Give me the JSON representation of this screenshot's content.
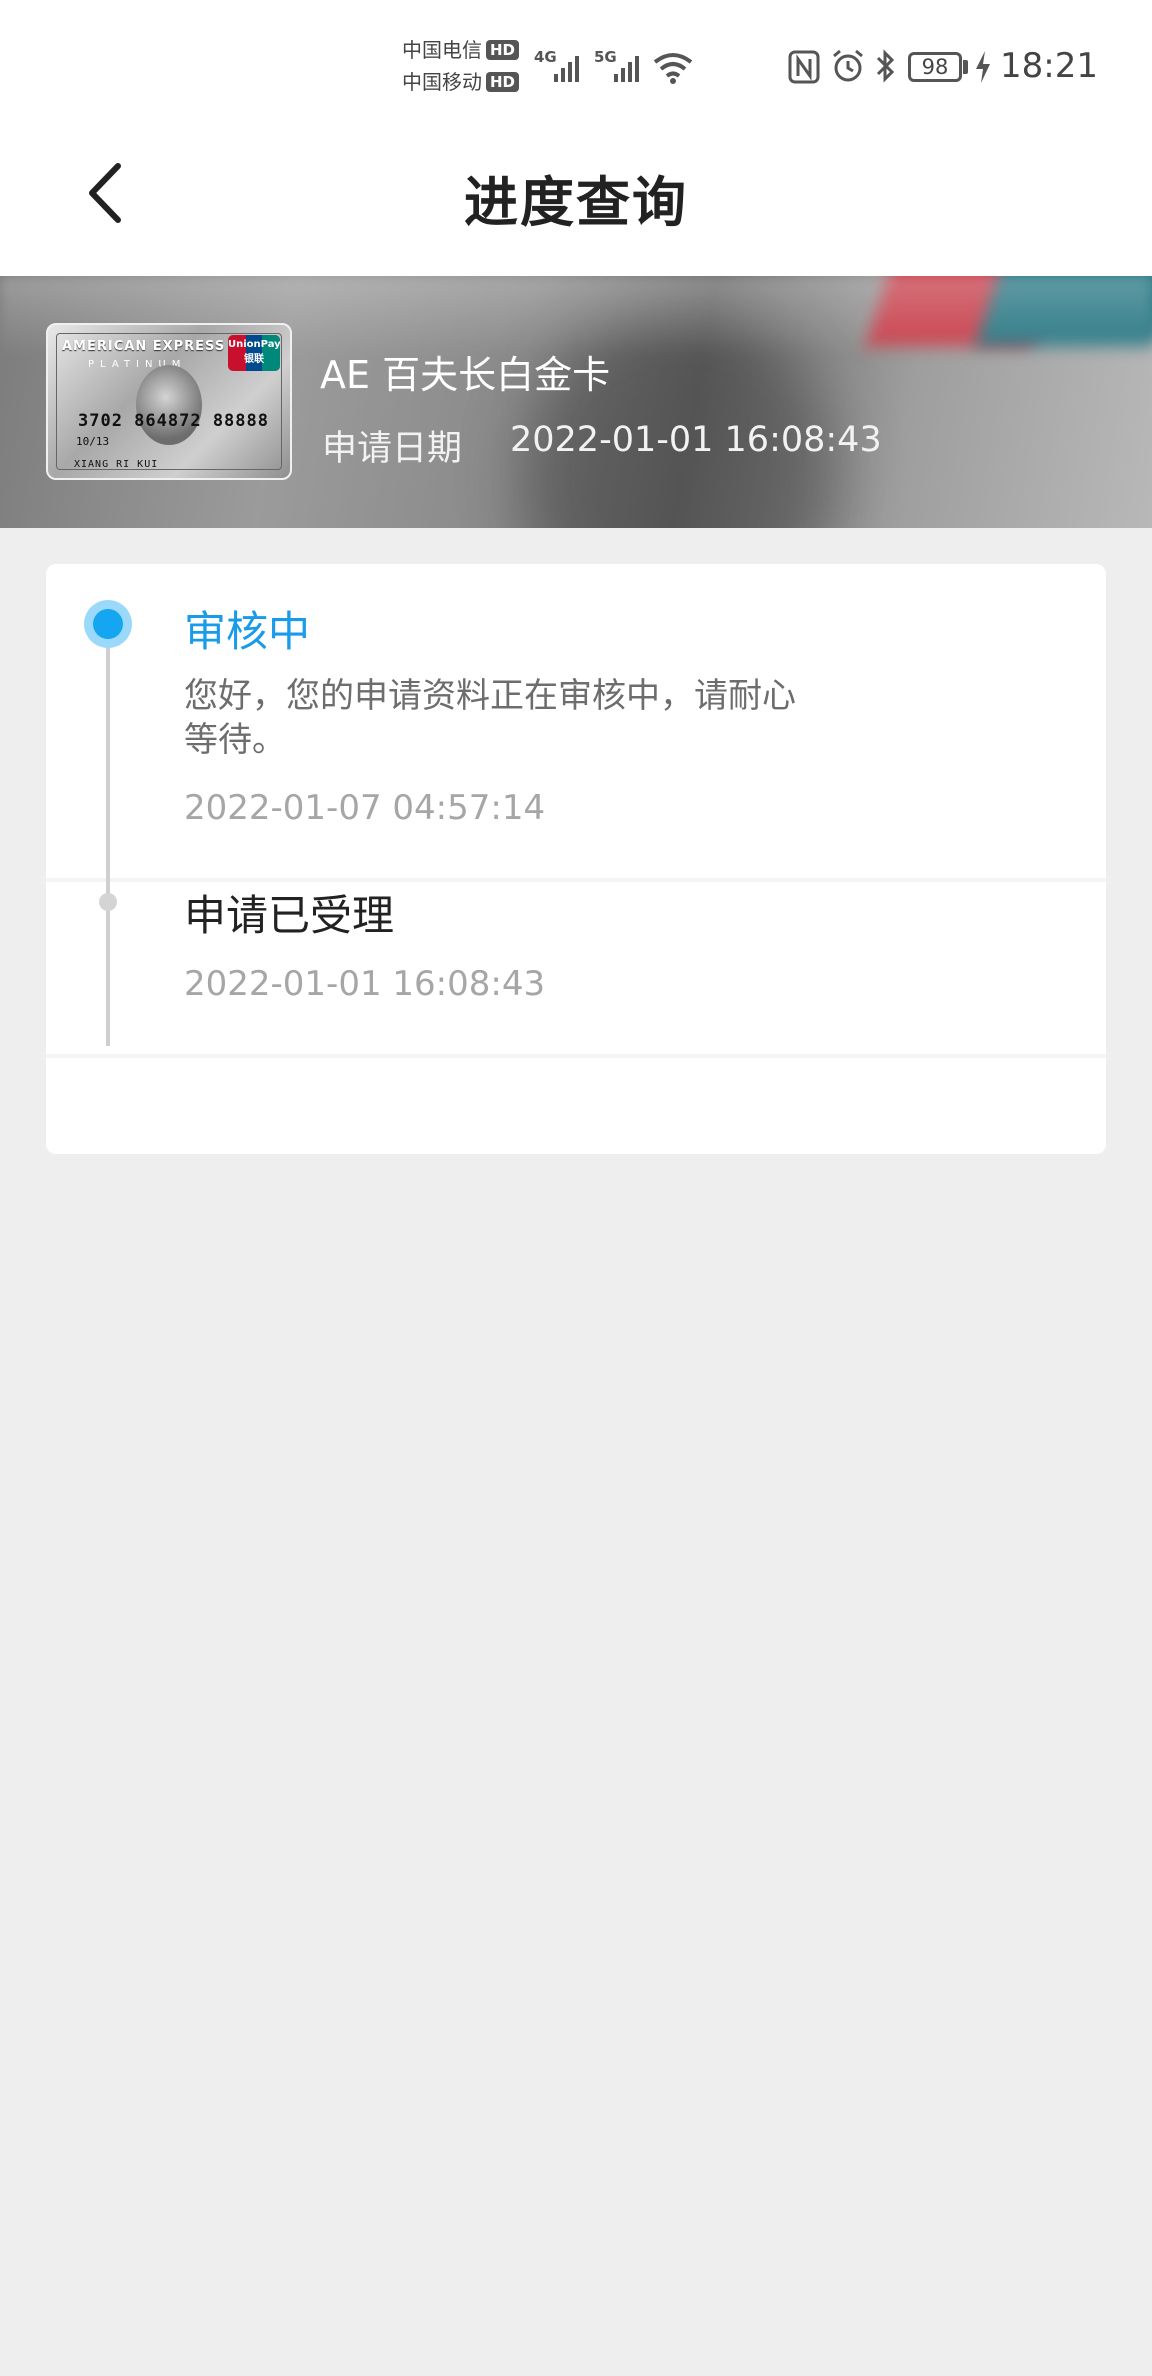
{
  "status_bar": {
    "carrier1": "中国电信",
    "carrier2": "中国移动",
    "hd_badge": "HD",
    "network1": "4G",
    "network2": "5G",
    "battery": "98",
    "time": "18:21"
  },
  "header": {
    "title": "进度查询"
  },
  "card": {
    "title": "AE 百夫长白金卡",
    "apply_date_label": "申请日期",
    "apply_date_value": "2022-01-01 16:08:43",
    "image": {
      "brand": "AMERICAN EXPRESS",
      "sub": "PLATINUM",
      "logo": "UnionPay 银联",
      "number": "3702 864872 88888",
      "date": "10/13",
      "name": "XIANG RI KUI"
    }
  },
  "timeline": [
    {
      "title": "审核中",
      "description": "您好，您的申请资料正在审核中，请耐心等待。",
      "time": "2022-01-07 04:57:14",
      "active": true
    },
    {
      "title": "申请已受理",
      "time": "2022-01-01 16:08:43",
      "active": false
    }
  ],
  "colors": {
    "accent": "#14a6f0",
    "background": "#eeeeee"
  }
}
